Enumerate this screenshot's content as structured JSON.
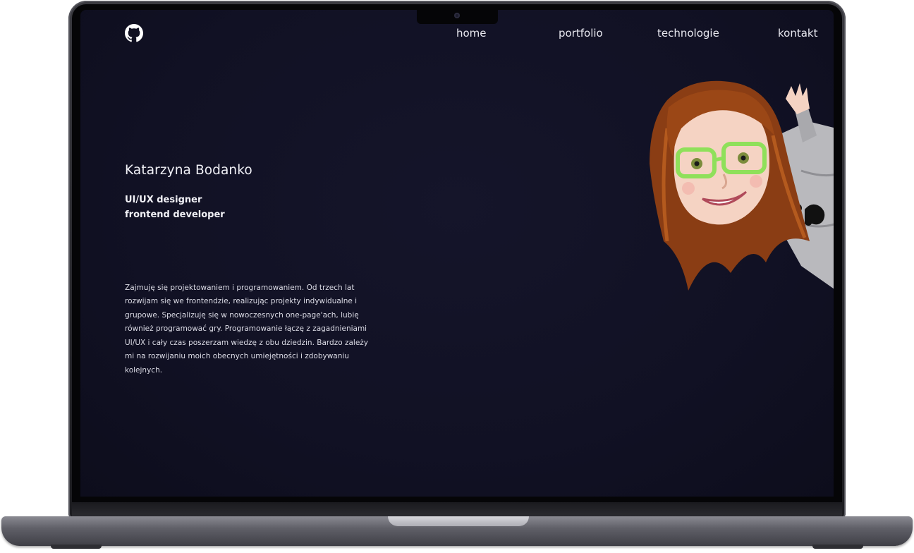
{
  "brand": {
    "logo_icon": "github-icon"
  },
  "nav": {
    "items": [
      {
        "label": "home"
      },
      {
        "label": "portfolio"
      },
      {
        "label": "technologie"
      },
      {
        "label": "kontakt"
      }
    ]
  },
  "hero": {
    "name": "Katarzyna Bodanko",
    "role_1": "UI/UX designer",
    "role_2": "frontend developer",
    "bio": "Zajmuję się projektowaniem i programowaniem. Od trzech lat rozwijam się we frontendzie, realizując projekty indywidualne i grupowe. Specjalizuję się w nowoczesnych one-page'ach, lubię również programować gry. Programowanie łączę z zagadnieniami UI/UX i cały czas poszerzam wiedzę z obu dziedzin. Bardzo zależy mi na rozwijaniu moich obecnych umiejętności i zdobywaniu kolejnych."
  },
  "colors": {
    "background": "#111124",
    "text": "#e8e8f0",
    "hair": "#8a3d14",
    "glasses": "#8fe05a",
    "sweater": "#b9b9bd"
  }
}
